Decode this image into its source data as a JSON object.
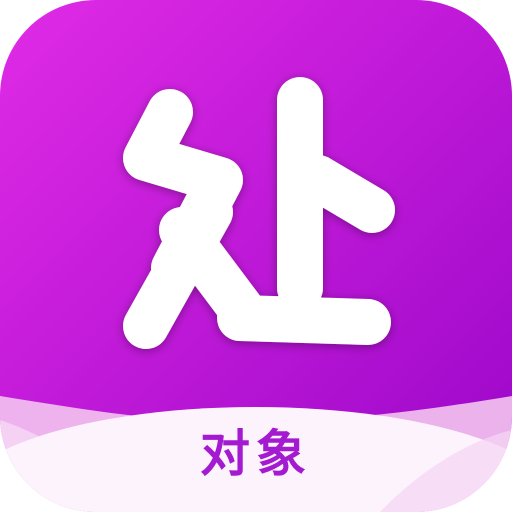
{
  "app": {
    "name": "对象",
    "logo_glyph": "处"
  },
  "colors": {
    "gradient_start": "#e02be6",
    "gradient_end": "#9a06c8",
    "glyph": "#ffffff",
    "label": "#a31ad1",
    "wave_front": "#fdf3fd",
    "wave_back": "#f3c4f0"
  },
  "icons": {
    "logo": "chu-character-logo-icon"
  }
}
